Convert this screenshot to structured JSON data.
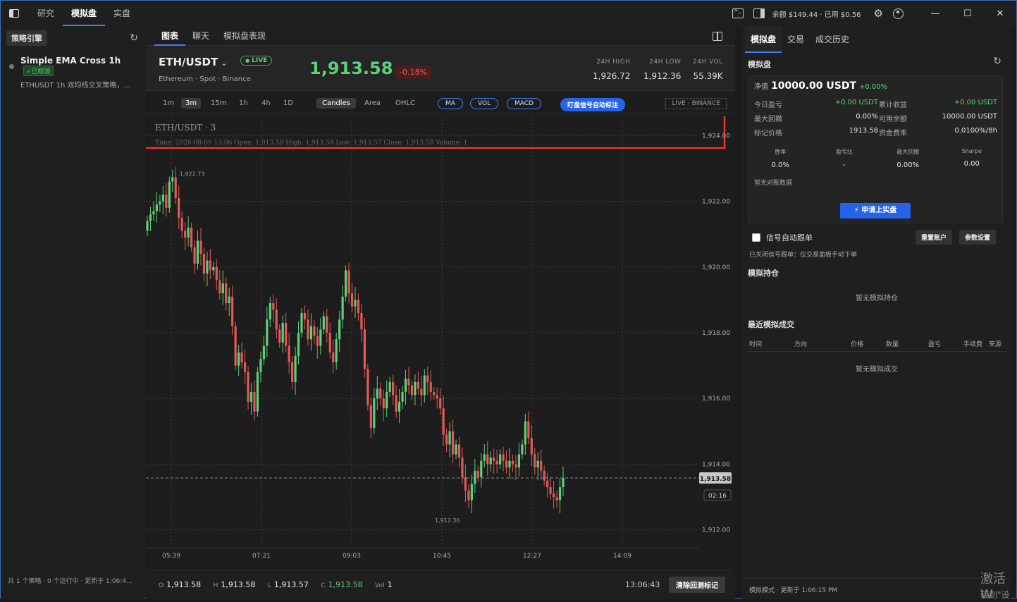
{
  "titlebar": {
    "tabs": [
      "研究",
      "模拟盘",
      "实盘"
    ],
    "balance": "余额 $149.44 · 已用 $0.56",
    "min": "—",
    "max": "☐",
    "close": "✕"
  },
  "left": {
    "header": "策略引擎",
    "strategy": {
      "name": "Simple EMA Cross 1h",
      "badge": "✓已校验",
      "desc": "ETHUSDT 1h 双均线交叉策略，..."
    },
    "footer": "共 1 个策略 · 0 个运行中 · 更新于 1:06:4..."
  },
  "center": {
    "tabs": [
      "图表",
      "聊天",
      "模拟盘表现"
    ],
    "symbol": "ETH/USDT",
    "live": "LIVE",
    "sub": "Ethereum · Spot · Binance",
    "price": "1,913.58",
    "change": "-0.18%",
    "stats": [
      {
        "label": "24H HIGH",
        "value": "1,926.72"
      },
      {
        "label": "24H LOW",
        "value": "1,912.36"
      },
      {
        "label": "24H VOL",
        "value": "55.39K"
      }
    ],
    "timeframes": [
      "1m",
      "3m",
      "15m",
      "1h",
      "4h",
      "1D"
    ],
    "active_tf": "3m",
    "chart_types": [
      "Candles",
      "Area",
      "OHLC"
    ],
    "indicators": [
      "MA",
      "VOL",
      "MACD"
    ],
    "signal_button": "盯盘信号自动标注",
    "source": "LIVE · BINANCE",
    "legend_title": "ETH/USDT · 3",
    "legend_line": "Time: 2026-08-09 13:06    Open: 1,913.58    High: 1,913.58    Low: 1,913.57    Close: 1,913.58    Volume: 1",
    "footer": {
      "o": "1,913.58",
      "h": "1,913.58",
      "l": "1,913.57",
      "c": "1,913.58",
      "vol": "1",
      "clock": "13:06:43",
      "clear": "清除回测标记"
    }
  },
  "chart_data": {
    "type": "candlestick",
    "y_ticks": [
      "1,924.00",
      "1,922.00",
      "1,920.00",
      "1,918.00",
      "1,916.00",
      "1,914.00",
      "1,912.00"
    ],
    "ylim": [
      1911.5,
      1924.5
    ],
    "x_ticks": [
      "05:39",
      "07:21",
      "09:03",
      "10:45",
      "12:27",
      "14:09"
    ],
    "last_price": 1913.58,
    "last_price_label": "1,913.58",
    "countdown": "02:16",
    "max_label": "1,922.73",
    "min_label": "1,912.36",
    "max_value": 1922.73,
    "min_value": 1912.36,
    "series": [
      1921.4,
      1921.6,
      1921.7,
      1921.9,
      1922.0,
      1922.2,
      1921.8,
      1922.6,
      1922.73,
      1922.1,
      1921.5,
      1921.1,
      1920.9,
      1921.2,
      1920.6,
      1920.1,
      1920.8,
      1920.4,
      1919.8,
      1920.2,
      1919.9,
      1920.0,
      1919.6,
      1919.2,
      1919.5,
      1918.9,
      1919.1,
      1918.2,
      1917.0,
      1917.4,
      1917.1,
      1916.8,
      1915.9,
      1916.2,
      1915.6,
      1916.8,
      1917.2,
      1917.6,
      1918.4,
      1918.9,
      1918.7,
      1918.1,
      1917.7,
      1918.3,
      1917.6,
      1917.1,
      1916.5,
      1917.3,
      1918.0,
      1918.6,
      1918.4,
      1917.8,
      1918.2,
      1917.9,
      1917.6,
      1918.1,
      1918.5,
      1918.0,
      1917.4,
      1917.1,
      1917.8,
      1918.4,
      1919.1,
      1919.9,
      1919.2,
      1918.8,
      1919.0,
      1918.6,
      1918.1,
      1916.9,
      1915.8,
      1915.1,
      1916.0,
      1916.3,
      1916.0,
      1915.7,
      1916.2,
      1916.5,
      1916.1,
      1915.6,
      1915.9,
      1916.2,
      1916.6,
      1916.4,
      1916.1,
      1916.5,
      1916.3,
      1916.1,
      1916.7,
      1916.5,
      1916.2,
      1916.1,
      1916.0,
      1915.7,
      1914.9,
      1914.6,
      1915.0,
      1914.3,
      1914.6,
      1914.2,
      1913.6,
      1913.2,
      1912.9,
      1913.4,
      1913.8,
      1913.6,
      1914.1,
      1914.3,
      1914.0,
      1914.2,
      1914.1,
      1914.0,
      1914.3,
      1914.1,
      1913.9,
      1914.1,
      1914.0,
      1913.9,
      1914.3,
      1914.6,
      1915.3,
      1914.8,
      1914.3,
      1913.9,
      1914.1,
      1913.8,
      1913.5,
      1913.3,
      1913.1,
      1913.0,
      1912.9,
      1913.3,
      1913.58
    ]
  },
  "right": {
    "tabs": [
      "模拟盘",
      "交易",
      "成交历史"
    ],
    "section": "模拟盘",
    "nav_label": "净值",
    "nav_value": "10000.00 USDT",
    "nav_chg": "+0.00%",
    "rows": [
      [
        "今日盈亏",
        "+0.00 USDT",
        "累计收益",
        "+0.00 USDT"
      ],
      [
        "最大回撤",
        "0.00%",
        "可用余额",
        "10000.00 USDT"
      ],
      [
        "标记价格",
        "1913.58",
        "资金费率",
        "0.0100%/8h"
      ]
    ],
    "stats": [
      [
        "胜率",
        "0.0%"
      ],
      [
        "盈亏比",
        "-"
      ],
      [
        "最大回撤",
        "0.00%"
      ],
      [
        "Sharpe",
        "0.00"
      ]
    ],
    "no_recon": "暂无对账数据",
    "apply": "⚡ 申请上实盘",
    "auto_follow": "信号自动跟单",
    "reset": "重置账户",
    "params": "参数设置",
    "note": "已关闭信号跟单：仅交易面板手动下单",
    "pos_title": "模拟持仓",
    "pos_empty": "暂无模拟持仓",
    "trades_title": "最近模拟成交",
    "cols": [
      "时间",
      "方向",
      "价格",
      "数量",
      "盈亏",
      "手续费",
      "来源"
    ],
    "trades_empty": "暂无模拟成交",
    "footer": "模拟模式 · 更新于 1:06:15 PM"
  },
  "watermark": {
    "line1": "激活 W",
    "line2": "转到\"设"
  },
  "colors": {
    "up": "#5fd07a",
    "down": "#e35858",
    "accent": "#3b82f6",
    "highlight_box": "#e53935"
  }
}
